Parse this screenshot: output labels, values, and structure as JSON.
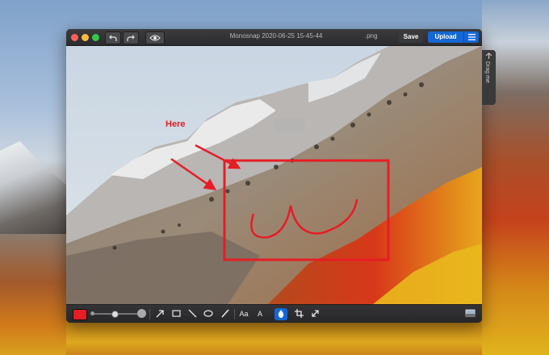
{
  "window": {
    "title": "Monosnap 2020-06-25 15-45-44",
    "extension": ".png",
    "save_label": "Save",
    "upload_label": "Upload",
    "menu_icon": "hamburger-icon"
  },
  "toolbar": {
    "undo_icon": "undo-icon",
    "redo_icon": "redo-icon",
    "preview_icon": "eye-icon"
  },
  "annotation": {
    "arrow_text": "Here",
    "color": "#e61d25"
  },
  "drag_tab": {
    "label": "Drag me"
  },
  "bottom_tools": {
    "font_label": "Aa",
    "blur_label": "A",
    "active_tool": "blur-drop",
    "stroke_color": "#e61d25"
  },
  "colors": {
    "accent": "#1467d4",
    "titlebar": "#2c2c2f"
  }
}
